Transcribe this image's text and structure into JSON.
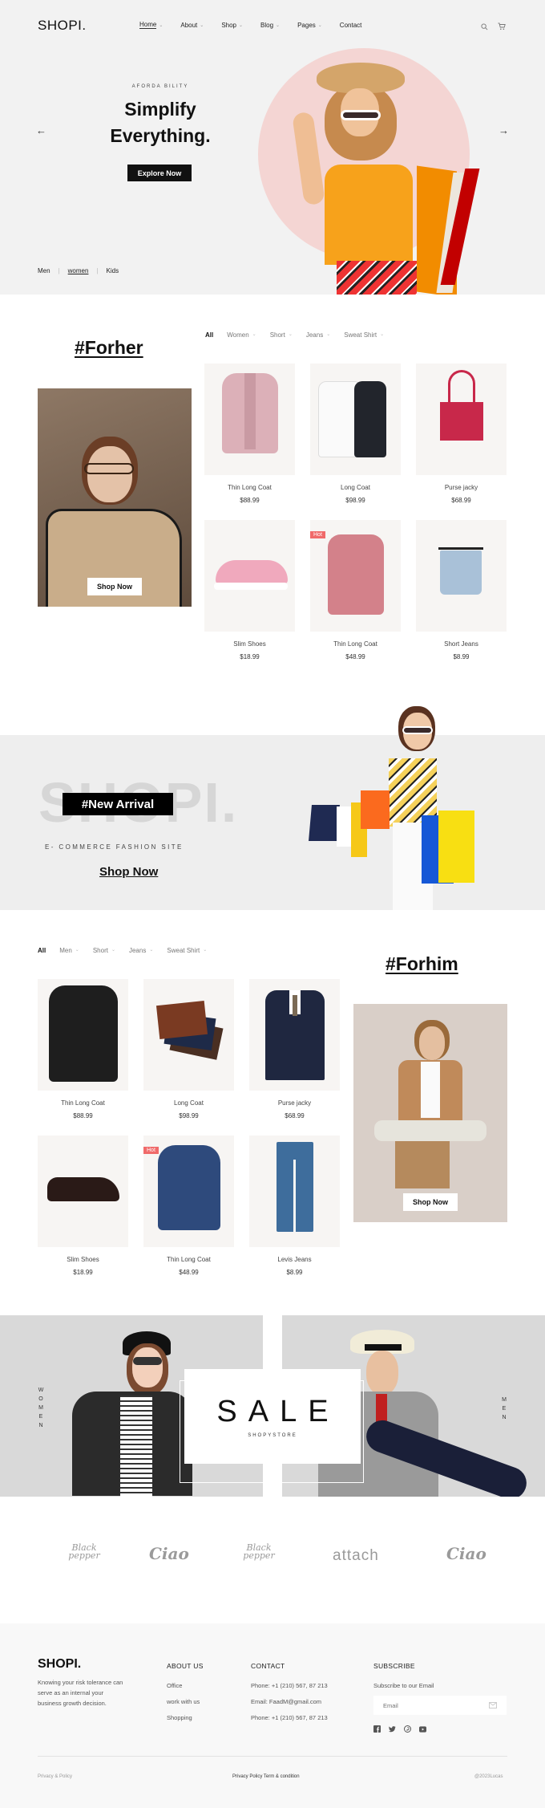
{
  "header": {
    "logo": "SHOPI.",
    "nav": [
      {
        "label": "Home",
        "dropdown": true,
        "active": true
      },
      {
        "label": "About",
        "dropdown": true
      },
      {
        "label": "Shop",
        "dropdown": true
      },
      {
        "label": "Blog",
        "dropdown": true
      },
      {
        "label": "Pages",
        "dropdown": true
      },
      {
        "label": "Contact",
        "dropdown": false
      }
    ],
    "icons": [
      "search-icon",
      "cart-icon"
    ]
  },
  "hero": {
    "eyebrow": "AFORDA BILITY",
    "headline_line1": "Simplify",
    "headline_line2": "Everything.",
    "cta": "Explore Now",
    "prev_arrow": "←",
    "next_arrow": "→",
    "categories": [
      {
        "label": "Men",
        "active": false
      },
      {
        "label": "women",
        "active": true
      },
      {
        "label": "Kids",
        "active": false
      }
    ],
    "circle_color": "#f4d5d3"
  },
  "forher": {
    "title": "#Forher",
    "shop_now": "Shop Now",
    "tabs": [
      {
        "label": "All",
        "active": true
      },
      {
        "label": "Women",
        "dropdown": true
      },
      {
        "label": "Short",
        "dropdown": true
      },
      {
        "label": "Jeans",
        "dropdown": true
      },
      {
        "label": "Sweat Shirt",
        "dropdown": true
      }
    ],
    "products": [
      {
        "name": "Thin Long Coat",
        "price": "$88.99",
        "hot": false
      },
      {
        "name": "Long Coat",
        "price": "$98.99",
        "hot": false
      },
      {
        "name": "Purse jacky",
        "price": "$68.99",
        "hot": false
      },
      {
        "name": "Slim Shoes",
        "price": "$18.99",
        "hot": false
      },
      {
        "name": "Thin Long Coat",
        "price": "$48.99",
        "hot": true
      },
      {
        "name": "Short Jeans",
        "price": "$8.99",
        "hot": false
      }
    ]
  },
  "arrival": {
    "ghost_text": "SHOPI.",
    "badge": "#New Arrival",
    "subtitle": "E- COMMERCE FASHION SITE",
    "shop_now": "Shop Now"
  },
  "forhim": {
    "title": "#Forhim",
    "shop_now": "Shop Now",
    "tabs": [
      {
        "label": "All",
        "active": true
      },
      {
        "label": "Men",
        "dropdown": true
      },
      {
        "label": "Short",
        "dropdown": true
      },
      {
        "label": "Jeans",
        "dropdown": true
      },
      {
        "label": "Sweat Shirt",
        "dropdown": true
      }
    ],
    "products": [
      {
        "name": "Thin Long Coat",
        "price": "$88.99",
        "hot": false
      },
      {
        "name": "Long Coat",
        "price": "$98.99",
        "hot": false
      },
      {
        "name": "Purse jacky",
        "price": "$68.99",
        "hot": false
      },
      {
        "name": "Slim Shoes",
        "price": "$18.99",
        "hot": false
      },
      {
        "name": "Thin Long Coat",
        "price": "$48.99",
        "hot": true
      },
      {
        "name": "Levis Jeans",
        "price": "$8.99",
        "hot": false
      }
    ]
  },
  "hot_label": "Hot",
  "sale": {
    "title": "SALE",
    "subtitle": "SHOPYSTORE",
    "left_label": "WOMEN",
    "right_label": "MEN"
  },
  "brands": [
    "Black pepper",
    "Ciao",
    "Black pepper",
    "attach",
    "Ciao"
  ],
  "footer": {
    "logo": "SHOPI.",
    "description": "Knowing your risk tolerance can serve as an internal your business growth decision.",
    "about": {
      "heading": "ABOUT US",
      "links": [
        "Office",
        "work with us",
        "Shopping"
      ]
    },
    "contact": {
      "heading": "CONTACT",
      "lines": [
        "Phone: +1 (210) 567, 87 213",
        "Email: FaadM@gmail.com",
        "Phone: +1 (210) 567, 87 213"
      ]
    },
    "subscribe": {
      "heading": "SUBSCRIBE",
      "text": "Subscribe to our Email",
      "placeholder": "Email",
      "social": [
        "facebook-icon",
        "twitter-icon",
        "pinterest-icon",
        "youtube-icon"
      ]
    },
    "bottom_left": "Privacy & Policy",
    "bottom_center": "Privacy Policy Term & condition",
    "bottom_right": "@2023Lucas"
  }
}
